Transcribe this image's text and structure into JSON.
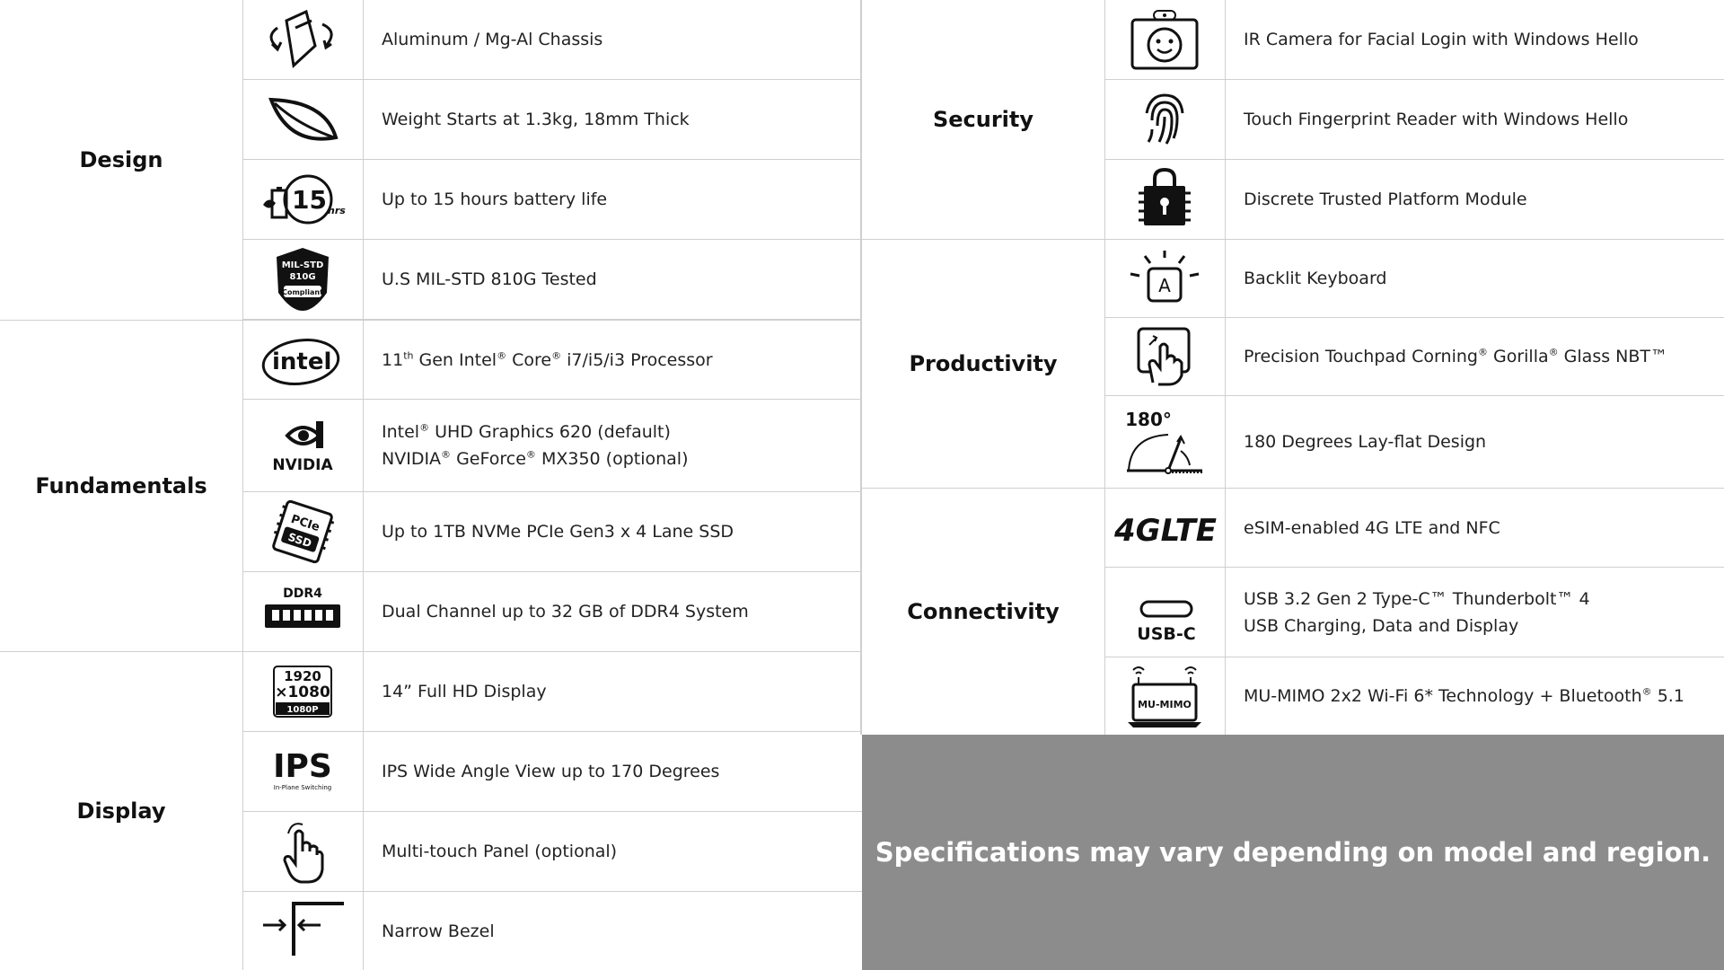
{
  "groups": {
    "design": "Design",
    "fundamentals": "Fundamentals",
    "display": "Display",
    "security": "Security",
    "productivity": "Productivity",
    "connectivity": "Connectivity"
  },
  "features": {
    "chassis": "Aluminum / Mg-Al Chassis",
    "weight": "Weight Starts at 1.3kg, 18mm Thick",
    "battery": "Up to 15 hours battery life",
    "milstd": "U.S MIL-STD 810G Tested",
    "cpu_a": "11",
    "cpu_sup": "th",
    "cpu_b": " Gen Intel",
    "cpu_c": " Core",
    "cpu_d": " i7/i5/i3 Processor",
    "gfx1_a": "Intel",
    "gfx1_b": " UHD Graphics 620 (default)",
    "gfx2_a": "NVIDIA",
    "gfx2_b": " GeForce",
    "gfx2_c": " MX350 (optional)",
    "ssd": "Up to 1TB NVMe PCIe Gen3 x 4 Lane SSD",
    "ram": "Dual Channel up to 32 GB of DDR4 System",
    "fhd": "14” Full HD Display",
    "ips": "IPS Wide Angle View up to 170 Degrees",
    "touch": "Multi-touch Panel (optional)",
    "bezel": "Narrow Bezel",
    "ircam": "IR Camera for Facial Login with Windows Hello",
    "finger": "Touch Fingerprint Reader with Windows Hello",
    "tpm": "Discrete Trusted Platform Module",
    "backlit": "Backlit Keyboard",
    "tp_a": "Precision Touchpad Corning",
    "tp_b": " Gorilla",
    "tp_c": " Glass NBT™",
    "lay": "180 Degrees Lay-flat Design",
    "lte": "eSIM-enabled 4G LTE and NFC",
    "usb1": "USB 3.2 Gen 2 Type-C™ Thunderbolt™ 4",
    "usb2": "USB Charging, Data and Display",
    "wifi_a": "MU-MIMO 2x2 Wi-Fi 6* Technology + Bluetooth",
    "wifi_b": " 5.1",
    "reg": "®"
  },
  "icon_text": {
    "battery_num": "15",
    "battery_unit": "hrs",
    "mil1": "MIL-STD",
    "mil2": "810G",
    "mil3": "Compliant",
    "intel": "intel",
    "nvidia": "NVIDIA",
    "pcie": "PCIe",
    "ssd": "SSD",
    "ddr4": "DDR4",
    "res1": "1920",
    "res2": "×1080",
    "res3": "1080P",
    "ips": "IPS",
    "ips_sub": "In-Plane Switching",
    "key": "A",
    "deg": "180°",
    "lte": "4GLTE",
    "usbc": "USB-C",
    "mumimo": "MU-MIMO"
  },
  "footer_note": "Specifications may vary depending on model and region."
}
